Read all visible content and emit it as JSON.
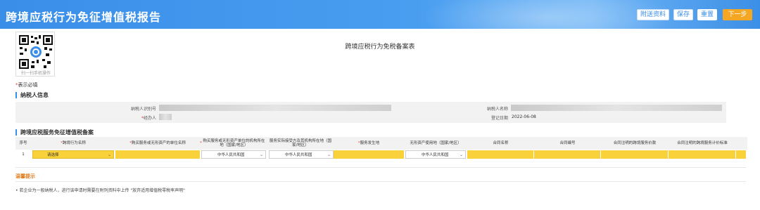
{
  "header": {
    "title": "跨境应税行为免征增值税报告",
    "buttons": {
      "attachments": "附送资料",
      "save": "保存",
      "reset": "重置",
      "next": "下一步"
    }
  },
  "qr": {
    "caption": "扫一扫手机操作"
  },
  "form_title": "跨境应税行为免税备案表",
  "required_note": {
    "star": "*",
    "text": "表示必填"
  },
  "taxpayer_section": {
    "title": "纳税人信息",
    "fields": {
      "tax_id_label": "纳税人识别号",
      "name_label": "纳税人名称",
      "handler_label": "经办人",
      "handler_star": "*",
      "reg_date_label": "登记日期",
      "reg_date_value": "2022-06-08"
    }
  },
  "service_section": {
    "title": "跨境应税服务免征增值税备案",
    "columns": [
      {
        "star": "",
        "label": "序号"
      },
      {
        "star": "*",
        "label": "跨境行为名称"
      },
      {
        "star": "*",
        "label": "购买服务或无形资产的单位名称"
      },
      {
        "star": "*",
        "label": "购买服务或无形资产单位的机构所在地（国家/地区）"
      },
      {
        "star": "",
        "label": "服务实际接受方及其机构所在地（国家/地区）"
      },
      {
        "star": "*",
        "label": "服务发生地"
      },
      {
        "star": "",
        "label": "无形资产使用地（国家/地区）"
      },
      {
        "star": "",
        "label": "合同名称"
      },
      {
        "star": "",
        "label": "合同编号"
      },
      {
        "star": "",
        "label": "合同注明的跨境服务价款"
      },
      {
        "star": "",
        "label": "合同注明的跨境服务计价标准"
      }
    ],
    "row": {
      "index": "1",
      "behavior_placeholder": "请选择",
      "country_1": "中华人民共和国",
      "country_2": "中华人民共和国",
      "country_3": "中华人民共和国"
    }
  },
  "tips": {
    "title": "温馨提示",
    "text": "• 若企业为一般纳税人，进行该申请时需要在附列资料中上传 \"放弃适用增值税零税率声明\""
  },
  "colors": {
    "header_blue": "#3a8ee8",
    "required_yellow": "#f9d13a",
    "next_orange": "#f5a623",
    "tip_orange": "#e07b1c"
  }
}
